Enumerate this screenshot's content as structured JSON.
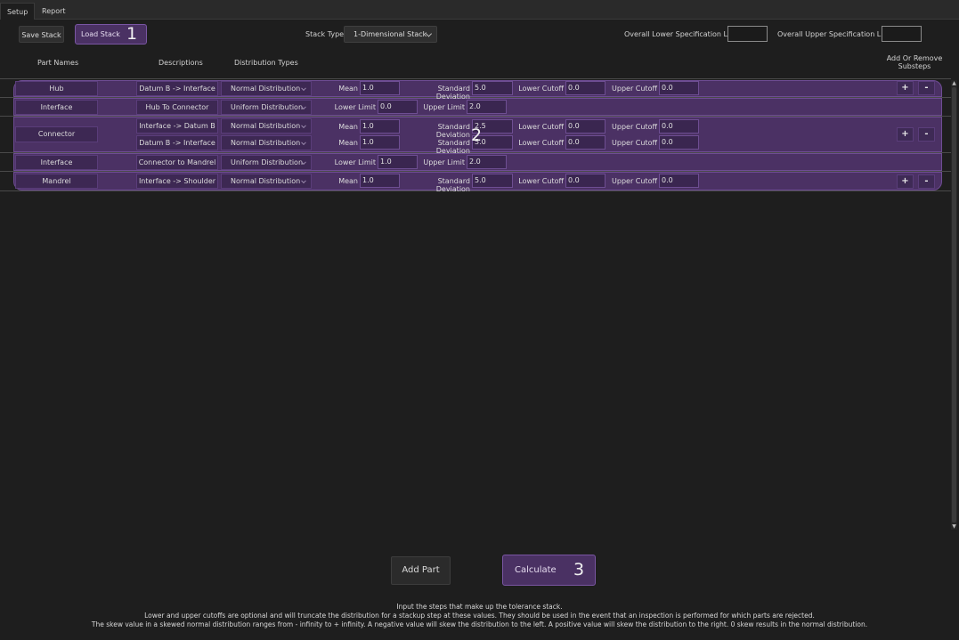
{
  "tabs": [
    {
      "label": "Setup"
    },
    {
      "label": "Report"
    }
  ],
  "toolbar": {
    "save_label": "Save Stack",
    "load_label": "Load Stack",
    "load_marker": "1",
    "stack_type_label": "Stack Type:",
    "stack_type_value": "1-Dimensional Stack",
    "lower_spec_label": "Overall Lower Specification Limit",
    "lower_spec_value": "",
    "upper_spec_label": "Overall Upper Specification Limit",
    "upper_spec_value": ""
  },
  "headers": {
    "part_names": "Part Names",
    "descriptions": "Descriptions",
    "distribution_types": "Distribution Types",
    "add_remove_line1": "Add Or Remove",
    "add_remove_line2": "Substeps"
  },
  "rows": [
    {
      "part": "Hub",
      "desc": "Datum B -> Interface",
      "dist": "Normal Distribution",
      "p1_label": "Mean",
      "p1": "1.0",
      "p2_label": "Standard Deviation",
      "p2": "5.0",
      "p3_label": "Lower Cutoff",
      "p3": "0.0",
      "p4_label": "Upper Cutoff",
      "p4": "0.0",
      "plus": "+",
      "minus": "-"
    },
    {
      "part": "Interface",
      "desc": "Hub To Connector",
      "dist": "Uniform Distribution",
      "p1_label": "Lower Limit",
      "p1": "0.0",
      "p2_label": "Upper Limit",
      "p2": "2.0"
    },
    {
      "part": "Connector",
      "plus": "+",
      "minus": "-",
      "marker": "2",
      "subs": [
        {
          "desc": "Interface -> Datum B",
          "dist": "Normal Distribution",
          "p1_label": "Mean",
          "p1": "1.0",
          "p2_label": "Standard Deviation",
          "p2": "2.5",
          "p3_label": "Lower Cutoff",
          "p3": "0.0",
          "p4_label": "Upper Cutoff",
          "p4": "0.0"
        },
        {
          "desc": "Datum B -> Interface",
          "dist": "Normal Distribution",
          "p1_label": "Mean",
          "p1": "1.0",
          "p2_label": "Standard Deviation",
          "p2": "5.0",
          "p3_label": "Lower Cutoff",
          "p3": "0.0",
          "p4_label": "Upper Cutoff",
          "p4": "0.0"
        }
      ]
    },
    {
      "part": "Interface",
      "desc": "Connector to Mandrel",
      "dist": "Uniform Distribution",
      "p1_label": "Lower Limit",
      "p1": "1.0",
      "p2_label": "Upper Limit",
      "p2": "2.0"
    },
    {
      "part": "Mandrel",
      "desc": "Interface -> Shoulder",
      "dist": "Normal Distribution",
      "p1_label": "Mean",
      "p1": "1.0",
      "p2_label": "Standard Deviation",
      "p2": "5.0",
      "p3_label": "Lower Cutoff",
      "p3": "0.0",
      "p4_label": "Upper Cutoff",
      "p4": "0.0",
      "plus": "+",
      "minus": "-"
    }
  ],
  "actions": {
    "add_part": "Add Part",
    "calculate": "Calculate",
    "calculate_marker": "3"
  },
  "footer": {
    "line1": "Input the steps that make up the tolerance stack.",
    "line2": "Lower and upper cutoffs are optional and will truncate the distribution for a stackup step at these values. They should be used in the event that an inspection is performed for which parts are rejected.",
    "line3": "The skew value in a skewed normal distribution ranges from - infinity to + infinity. A negative value will skew the distribution to the left. A positive value will skew the distribution to the right. 0 skew results in the normal distribution."
  },
  "colors": {
    "accent_purple": "#4b3164",
    "accent_border": "#6e4c93",
    "background": "#1e1e1e"
  }
}
